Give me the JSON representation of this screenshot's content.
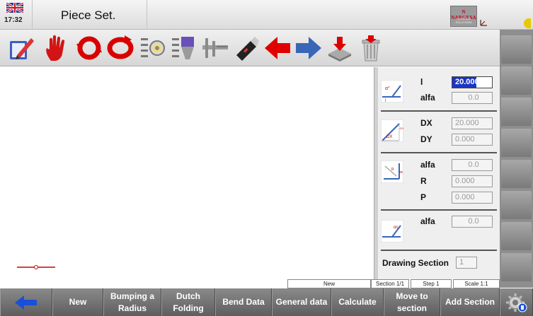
{
  "header": {
    "clock": "17:32",
    "title": "Piece Set.",
    "logo_line1": "N NARGESA",
    "logo_line2": "WORKING SOLUTIONS"
  },
  "toolbar": {
    "icons": [
      "edit-icon",
      "stop-hand-icon",
      "rotate-left-icon",
      "rotate-right-icon",
      "light-settings-icon",
      "tool-settings-icon",
      "caliper-icon",
      "usb-drive-icon",
      "arrow-left-icon",
      "arrow-right-icon",
      "download-tray-icon",
      "trash-icon"
    ]
  },
  "panel": {
    "l_label": "l",
    "l_value": "20.000",
    "alfa1_label": "alfa",
    "alfa1_value": "0.0",
    "dx_label": "DX",
    "dx_value": "20.000",
    "dy_label": "DY",
    "dy_value": "0.000",
    "alfa2_label": "alfa",
    "alfa2_value": "0.0",
    "r_label": "R",
    "r_value": "0.000",
    "p_label": "P",
    "p_value": "0.000",
    "alfa3_label": "alfa",
    "alfa3_value": "0.0",
    "drawing_section_label": "Drawing Section",
    "drawing_section_value": "1",
    "icon_small_alpha": "α°",
    "icon_small_l": "l",
    "icon_dx": "DX",
    "icon_dy": "DY",
    "icon_alpha": "αc",
    "icon_r": "R",
    "icon_alpha3": "αc"
  },
  "status": {
    "mode": "New",
    "section": "Section 1/1",
    "step": "Step 1",
    "scale": "Scale 1:1"
  },
  "bottom": {
    "new": "New",
    "bumping_line1": "Bumping a",
    "bumping_line2": "Radius",
    "dutch_line1": "Dutch",
    "dutch_line2": "Folding",
    "bend_data": "Bend Data",
    "general_data": "General data",
    "calculate": "Calculate",
    "move_line1": "Move to",
    "move_line2": "section",
    "add_section": "Add Section"
  },
  "colors": {
    "accent_blue": "#1b36c4",
    "piece_red": "#cc0000",
    "toolbar_red": "#e00000",
    "arrow_blue": "#3a66b8"
  }
}
